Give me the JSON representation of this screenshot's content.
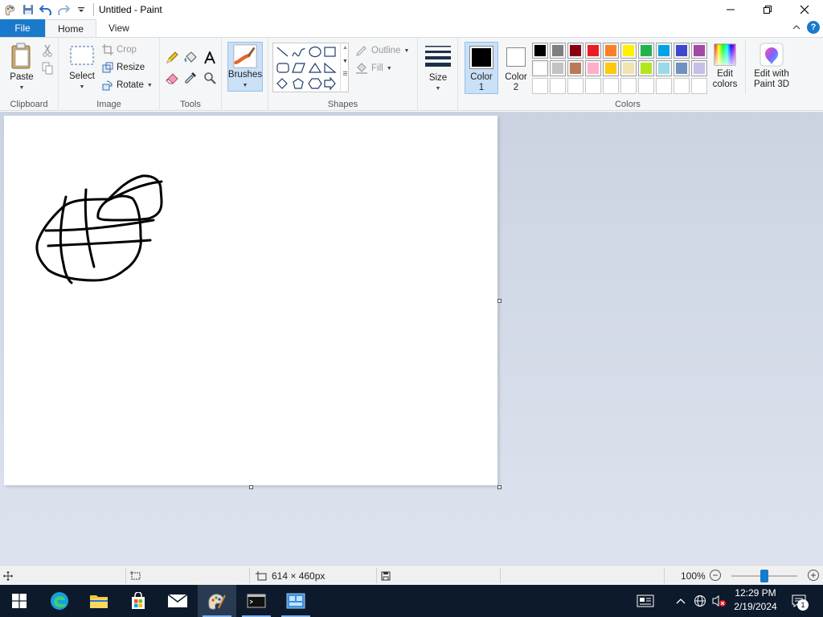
{
  "window": {
    "title": "Untitled - Paint"
  },
  "tabs": {
    "file": "File",
    "home": "Home",
    "view": "View"
  },
  "ribbon": {
    "clipboard": {
      "label": "Clipboard",
      "paste": "Paste"
    },
    "image": {
      "label": "Image",
      "select": "Select",
      "crop": "Crop",
      "resize": "Resize",
      "rotate": "Rotate"
    },
    "tools": {
      "label": "Tools"
    },
    "brushes": {
      "label": "Brushes"
    },
    "shapes": {
      "label": "Shapes",
      "outline": "Outline",
      "fill": "Fill"
    },
    "size": {
      "label": "Size"
    },
    "colors": {
      "label": "Colors",
      "color1_line1": "Color",
      "color1_line2": "1",
      "color2_line1": "Color",
      "color2_line2": "2",
      "edit_line1": "Edit",
      "edit_line2": "colors",
      "paint3d_line1": "Edit with",
      "paint3d_line2": "Paint 3D",
      "color1_value": "#000000",
      "color2_value": "#ffffff",
      "palette_row1": [
        "#000000",
        "#7f7f7f",
        "#880015",
        "#ed1c24",
        "#ff7f27",
        "#fff200",
        "#22b14c",
        "#00a2e8",
        "#3f48cc",
        "#a349a4"
      ],
      "palette_row2": [
        "#ffffff",
        "#c3c3c3",
        "#b97a57",
        "#ffaec9",
        "#ffc90e",
        "#efe4b0",
        "#b5e61d",
        "#99d9ea",
        "#7092be",
        "#c8bfe7"
      ],
      "palette_row3": [
        "",
        "",
        "",
        "",
        "",
        "",
        "",
        "",
        "",
        ""
      ]
    }
  },
  "status": {
    "canvas_size": "614 × 460px",
    "zoom": "100%",
    "zoom_fraction": 0.5
  },
  "taskbar": {
    "time": "12:29 PM",
    "date": "2/19/2024",
    "notification_count": "1",
    "apps": [
      "start-icon",
      "edge-icon",
      "file-explorer-icon",
      "store-icon",
      "mail-icon",
      "paint-icon",
      "terminal-icon",
      "network-app-icon"
    ]
  }
}
